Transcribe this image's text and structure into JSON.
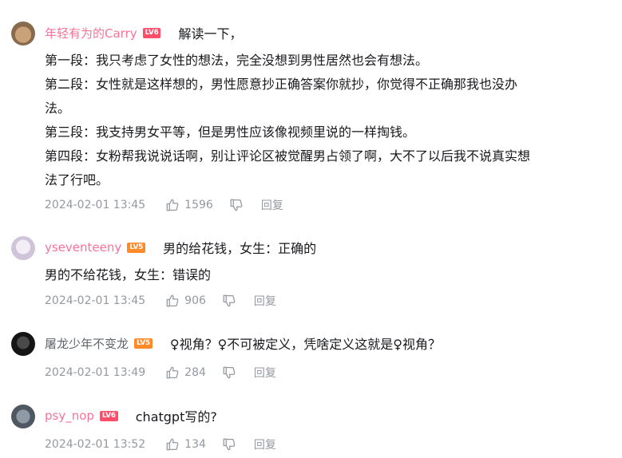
{
  "comments": [
    {
      "username": "年轻有为的Carry",
      "level": "LV6",
      "first_line": "解读一下，",
      "lines": [
        "第一段：我只考虑了女性的想法，完全没想到男性居然也会有想法。",
        "第二段：女性就是这样想的，男性愿意抄正确答案你就抄，你觉得不正确那我也没办",
        "法。",
        "第三段：我支持男女平等，但是男性应该像视频里说的一样掏钱。",
        "第四段：女粉帮我说说话啊，别让评论区被觉醒男占领了啊，大不了以后我不说真实想",
        "法了行吧。"
      ],
      "time": "2024-02-01 13:45",
      "likes": "1596",
      "reply_label": "回复"
    },
    {
      "username": "yseventeeny",
      "level": "LV5",
      "first_line": "男的给花钱，女生：正确的",
      "lines": [
        "男的不给花钱，女生：错误的"
      ],
      "time": "2024-02-01 13:45",
      "likes": "906",
      "reply_label": "回复"
    },
    {
      "username": "屠龙少年不变龙",
      "level": "LV5",
      "first_line": "♀视角？♀不可被定义，凭啥定义这就是♀视角？",
      "lines": [],
      "time": "2024-02-01 13:49",
      "likes": "284",
      "reply_label": "回复"
    },
    {
      "username": "psy_nop",
      "level": "LV6",
      "first_line": "chatgpt写的?",
      "lines": [],
      "time": "2024-02-01 13:52",
      "likes": "134",
      "reply_label": "回复"
    }
  ],
  "colors": {
    "username_vip": "#fb7299",
    "username_normal": "#61666d",
    "meta_gray": "#9499a0",
    "level6": "#ff4e6a",
    "level5": "#ff8a2a"
  }
}
